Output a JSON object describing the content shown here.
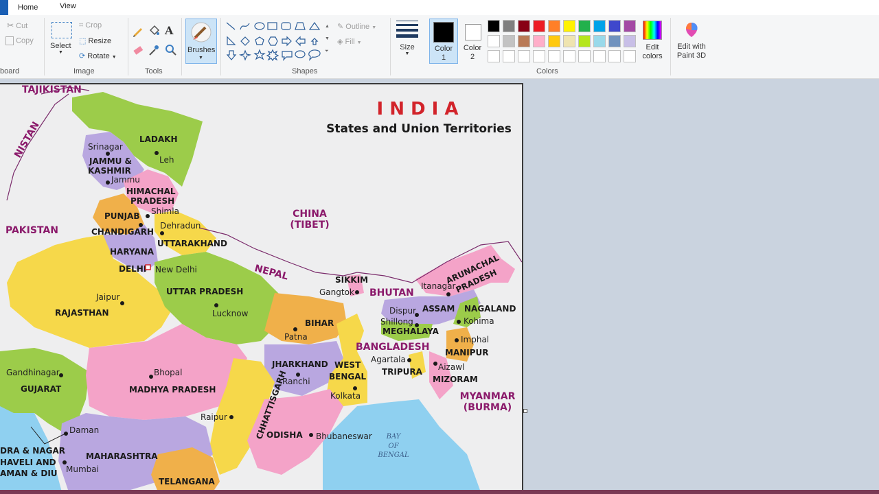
{
  "tabs": {
    "home": "Home",
    "view": "View"
  },
  "clipboard": {
    "cut": "Cut",
    "copy": "Copy",
    "group": "board"
  },
  "image": {
    "select": "Select",
    "crop": "Crop",
    "resize": "Resize",
    "rotate": "Rotate",
    "group": "Image"
  },
  "tools": {
    "group": "Tools"
  },
  "brushes": {
    "label": "Brushes"
  },
  "shapes": {
    "outline": "Outline",
    "fill": "Fill",
    "group": "Shapes"
  },
  "size": {
    "label": "Size"
  },
  "color1": {
    "label": "Color",
    "num": "1",
    "value": "#000000"
  },
  "color2": {
    "label": "Color",
    "num": "2",
    "value": "#ffffff"
  },
  "colors": {
    "group": "Colors",
    "row1": [
      "#000000",
      "#7f7f7f",
      "#880015",
      "#ed1c24",
      "#ff7f27",
      "#fff200",
      "#22b14c",
      "#00a2e8",
      "#3f48cc",
      "#a349a4"
    ],
    "row2": [
      "#ffffff",
      "#c3c3c3",
      "#b97a57",
      "#ffaec9",
      "#ffc90e",
      "#efe4b0",
      "#b5e61d",
      "#99d9ea",
      "#7092be",
      "#c8bfe7"
    ]
  },
  "edit_colors": {
    "line1": "Edit",
    "line2": "colors"
  },
  "edit_paint3d": {
    "line1": "Edit with",
    "line2": "Paint 3D"
  },
  "map": {
    "title": "I N D I A",
    "subtitle": "States and Union Territories",
    "countries": {
      "tajikistan": "TAJIKISTAN",
      "afghanistan": "NISTAN",
      "pakistan": "PAKISTAN",
      "china": "CHINA",
      "tibet": "(TIBET)",
      "nepal": "NEPAL",
      "bhutan": "BHUTAN",
      "bangladesh": "BANGLADESH",
      "myanmar": "MYANMAR",
      "burma": "(BURMA)"
    },
    "sea": {
      "l1": "BAY",
      "l2": "OF",
      "l3": "BENGAL"
    },
    "states": {
      "ladakh": "LADAKH",
      "jk1": "JAMMU &",
      "jk2": "KASHMIR",
      "hp1": "HIMACHAL",
      "hp2": "PRADESH",
      "punjab": "PUNJAB",
      "chandigarh": "CHANDIGARH",
      "uttarakhand": "UTTARAKHAND",
      "haryana": "HARYANA",
      "delhi": "DELHI",
      "rajasthan": "RAJASTHAN",
      "up": "UTTAR PRADESH",
      "bihar": "BIHAR",
      "sikkim": "SIKKIM",
      "arunachal1": "ARUNACHAL",
      "arunachal2": "PRADESH",
      "assam": "ASSAM",
      "nagaland": "NAGALAND",
      "meghalaya": "MEGHALAYA",
      "manipur": "MANIPUR",
      "mizoram": "MIZORAM",
      "tripura": "TRIPURA",
      "jharkhand": "JHARKHAND",
      "wb1": "WEST",
      "wb2": "BENGAL",
      "gujarat": "GUJARAT",
      "mp": "MADHYA PRADESH",
      "chhattisgarh": "CHHATTISGARH",
      "odisha": "ODISHA",
      "maharashtra": "MAHARASHTRA",
      "telangana": "TELANGANA",
      "dnh1": "DRA & NAGAR",
      "dnh2": "HAVELI AND",
      "dnh3": "AMAN & DIU"
    },
    "cities": {
      "srinagar": "Srinagar",
      "leh": "Leh",
      "jammu": "Jammu",
      "shimla": "Shimla",
      "dehradun": "Dehradun",
      "newdelhi": "New Delhi",
      "jaipur": "Jaipur",
      "lucknow": "Lucknow",
      "patna": "Patna",
      "gangtok": "Gangtok",
      "itanagar": "Itanagar",
      "dispur": "Dispur",
      "shillong": "Shillong",
      "kohima": "Kohima",
      "imphal": "Imphal",
      "aizawl": "Aizawl",
      "agartala": "Agartala",
      "ranchi": "Ranchi",
      "kolkata": "Kolkata",
      "gandhinagar": "Gandhinagar",
      "bhopal": "Bhopal",
      "raipur": "Raipur",
      "bhubaneswar": "Bhubaneswar",
      "daman": "Daman",
      "mumbai": "Mumbai"
    }
  }
}
